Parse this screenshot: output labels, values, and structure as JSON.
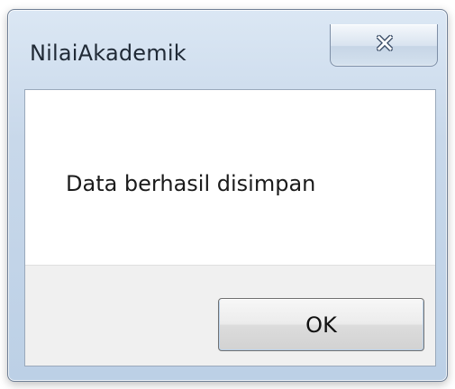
{
  "window": {
    "title": "NilaiAkademik",
    "close_symbol": "✕",
    "close_icon": "close-icon"
  },
  "dialog": {
    "message": "Data berhasil disimpan",
    "ok_label": "OK"
  }
}
